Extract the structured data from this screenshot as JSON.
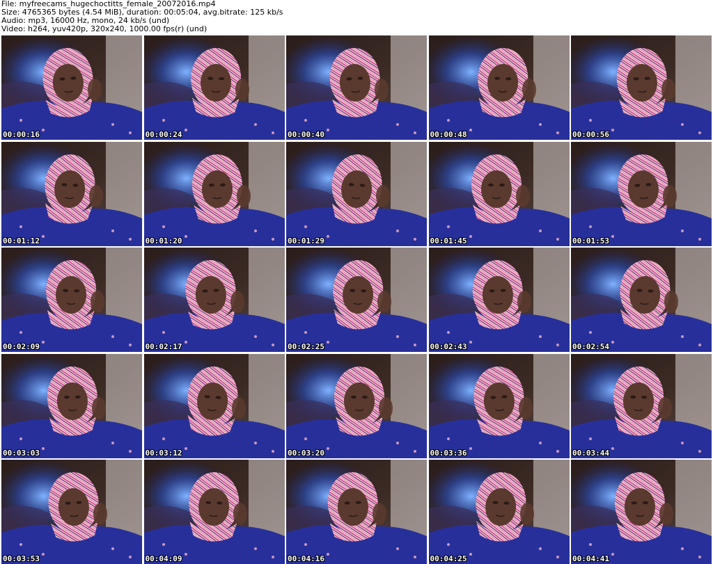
{
  "info": {
    "file": "File: myfreecams_hugechoctitts_female_20072016.mp4",
    "size": "Size: 4765365 bytes (4.54 MiB), duration: 00:05:04, avg.bitrate: 125 kb/s",
    "audio": "Audio: mp3, 16000 Hz, mono, 24 kb/s (und)",
    "video": "Video: h264, yuv420p, 320x240, 1000.00 fps(r) (und)"
  },
  "thumbnails": [
    {
      "timestamp": "00:00:16"
    },
    {
      "timestamp": "00:00:24"
    },
    {
      "timestamp": "00:00:40"
    },
    {
      "timestamp": "00:00:48"
    },
    {
      "timestamp": "00:00:56"
    },
    {
      "timestamp": "00:01:12"
    },
    {
      "timestamp": "00:01:20"
    },
    {
      "timestamp": "00:01:29"
    },
    {
      "timestamp": "00:01:45"
    },
    {
      "timestamp": "00:01:53"
    },
    {
      "timestamp": "00:02:09"
    },
    {
      "timestamp": "00:02:17"
    },
    {
      "timestamp": "00:02:25"
    },
    {
      "timestamp": "00:02:43"
    },
    {
      "timestamp": "00:02:54"
    },
    {
      "timestamp": "00:03:03"
    },
    {
      "timestamp": "00:03:12"
    },
    {
      "timestamp": "00:03:20"
    },
    {
      "timestamp": "00:03:36"
    },
    {
      "timestamp": "00:03:44"
    },
    {
      "timestamp": "00:03:53"
    },
    {
      "timestamp": "00:04:09"
    },
    {
      "timestamp": "00:04:16"
    },
    {
      "timestamp": "00:04:25"
    },
    {
      "timestamp": "00:04:41"
    }
  ],
  "colors": {
    "background": "#ffffff",
    "text": "#000000",
    "timestamp": "#ffffff",
    "headboard": "#3b2a24",
    "sweater": "#27309a",
    "scarf_pink": "#d2559a",
    "scarf_cream": "#efe3d2",
    "skin": "#5a3a2e"
  }
}
